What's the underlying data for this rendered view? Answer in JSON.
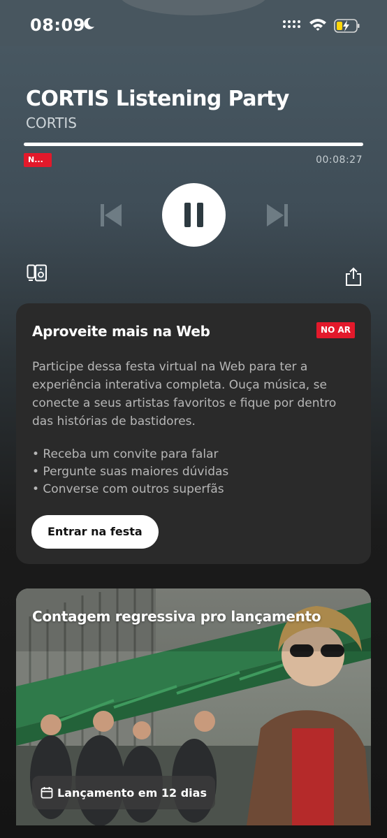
{
  "status_bar": {
    "time": "08:09"
  },
  "player": {
    "title": "CORTIS Listening Party",
    "artist": "CORTIS",
    "live_mini_label": "N...",
    "elapsed": "00:08:27",
    "progress": 1.0
  },
  "web_card": {
    "title": "Aproveite mais na Web",
    "badge": "NO AR",
    "description": "Participe dessa festa virtual na Web para ter a experiência interativa completa. Ouça música, se conecte a seus artistas favoritos e fique por dentro das histórias de bastidores.",
    "bullets": [
      "• Receba um convite para falar",
      "• Pergunte suas maiores dúvidas",
      "• Converse com outros superfãs"
    ],
    "button_label": "Entrar na festa"
  },
  "countdown_card": {
    "title": "Contagem regressiva pro lançamento",
    "pill_label": "Lançamento em 12 dias"
  },
  "colors": {
    "live_red": "#e3192b",
    "card_bg": "#2a2a2a"
  },
  "icons": [
    "moon-icon",
    "signal-icon",
    "wifi-icon",
    "battery-icon",
    "previous-icon",
    "pause-icon",
    "next-icon",
    "device-icon",
    "share-icon",
    "calendar-icon"
  ]
}
